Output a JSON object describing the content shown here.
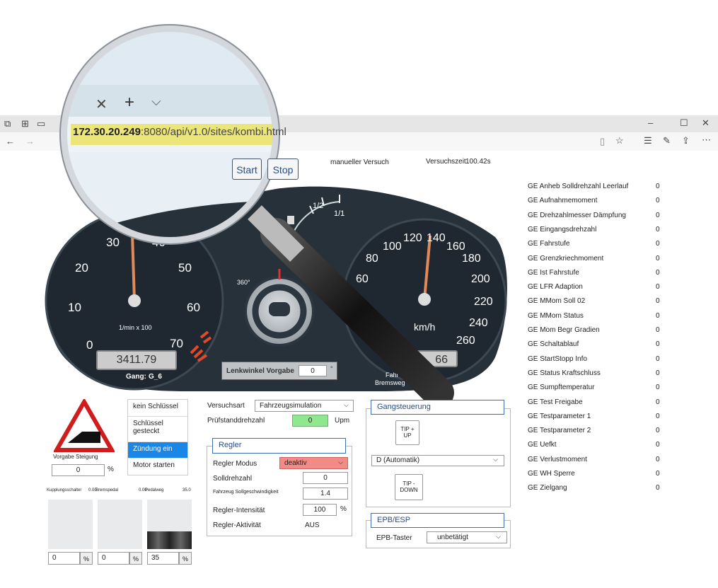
{
  "browser": {
    "url_host": "172.30.20.249",
    "url_rest": ":8080/api/v1.0/sites/kombi.html",
    "controls": {
      "minimize": "–",
      "maximize": "☐",
      "close": "✕"
    }
  },
  "toolbar": {
    "start_label": "Start",
    "stop_label": "Stop",
    "mode_text": "manueller Versuch",
    "time_label": "Versuchszeit",
    "time_value": "100.42s"
  },
  "cluster": {
    "rpm_ticks": [
      "0",
      "10",
      "20",
      "30",
      "40",
      "50",
      "60",
      "70"
    ],
    "rpm_unit": "1/min x 100",
    "rpm_value": "3411.79",
    "gear_label": "Gang:",
    "gear_value": "G_6",
    "speed_ticks": [
      "60",
      "80",
      "100",
      "120",
      "140",
      "160",
      "180",
      "200",
      "220",
      "240",
      "260"
    ],
    "speed_unit": "km/h",
    "speed_value": "66",
    "fuel_marks": [
      "1/2",
      "1/1"
    ],
    "angle_label": "360°",
    "steer_label": "Lenkwinkel Vorgabe",
    "steer_value": "0",
    "steer_unit": "°",
    "brake_line1": "Fahr",
    "brake_line2": "Bremsweg"
  },
  "incline": {
    "label": "Vorgabe Steigung",
    "value": "0",
    "unit": "%"
  },
  "key_menu": {
    "items": [
      "kein Schlüssel",
      "Schlüssel gesteckt",
      "Zündung ein",
      "Motor starten"
    ],
    "active_index": 2
  },
  "pedals": {
    "clutch_label": "Kupplungsschalter",
    "clutch_value": "0.00",
    "brake_label": "Bremspedal",
    "brake_value": "0.00",
    "gas_label": "Pedalweg",
    "gas_value": "35.0",
    "inputs": [
      "0",
      "0",
      "35"
    ],
    "unit": "%"
  },
  "test": {
    "mode_label": "Versuchsart",
    "mode_value": "Fahrzeugsimulation",
    "speed_label": "Prüfstanddrehzahl",
    "speed_value": "0",
    "speed_unit": "Upm"
  },
  "regler": {
    "title": "Regler",
    "mode_label": "Regler Modus",
    "mode_value": "deaktiv",
    "target_rpm_label": "Solldrehzahl",
    "target_rpm_value": "0",
    "target_speed_label": "Fahrzeug Sollgeschwindigkeit",
    "target_speed_value": "1.4",
    "intensity_label": "Regler-Intensität",
    "intensity_value": "100",
    "intensity_unit": "%",
    "activity_label": "Regler-Aktivität",
    "activity_value": "AUS"
  },
  "gear": {
    "title": "Gangsteuerung",
    "tip_up": [
      "TIP +",
      "UP"
    ],
    "tip_down": [
      "TIP -",
      "DOWN"
    ],
    "selected": "D (Automatik)"
  },
  "epb": {
    "title": "EPB/ESP",
    "label": "EPB-Taster",
    "value": "unbetätigt"
  },
  "signals": [
    {
      "name": "GE Anheb Solldrehzahl Leerlauf",
      "value": "0"
    },
    {
      "name": "GE Aufnahmemoment",
      "value": "0"
    },
    {
      "name": "GE Drehzahlmesser Dämpfung",
      "value": "0"
    },
    {
      "name": "GE Eingangsdrehzahl",
      "value": "0"
    },
    {
      "name": "GE Fahrstufe",
      "value": "0"
    },
    {
      "name": "GE Grenzkriechmoment",
      "value": "0"
    },
    {
      "name": "GE Ist Fahrstufe",
      "value": "0"
    },
    {
      "name": "GE LFR Adaption",
      "value": "0"
    },
    {
      "name": "GE MMom Soll 02",
      "value": "0"
    },
    {
      "name": "GE MMom Status",
      "value": "0"
    },
    {
      "name": "GE Mom Begr Gradien",
      "value": "0"
    },
    {
      "name": "GE Schaltablauf",
      "value": "0"
    },
    {
      "name": "GE StartStopp Info",
      "value": "0"
    },
    {
      "name": "GE Status Kraftschluss",
      "value": "0"
    },
    {
      "name": "GE Sumpftemperatur",
      "value": "0"
    },
    {
      "name": "GE Test Freigabe",
      "value": "0"
    },
    {
      "name": "GE Testparameter 1",
      "value": "0"
    },
    {
      "name": "GE Testparameter 2",
      "value": "0"
    },
    {
      "name": "GE Uefkt",
      "value": "0"
    },
    {
      "name": "GE Verlustmoment",
      "value": "0"
    },
    {
      "name": "GE WH Sperre",
      "value": "0"
    },
    {
      "name": "GE Zielgang",
      "value": "0"
    }
  ]
}
